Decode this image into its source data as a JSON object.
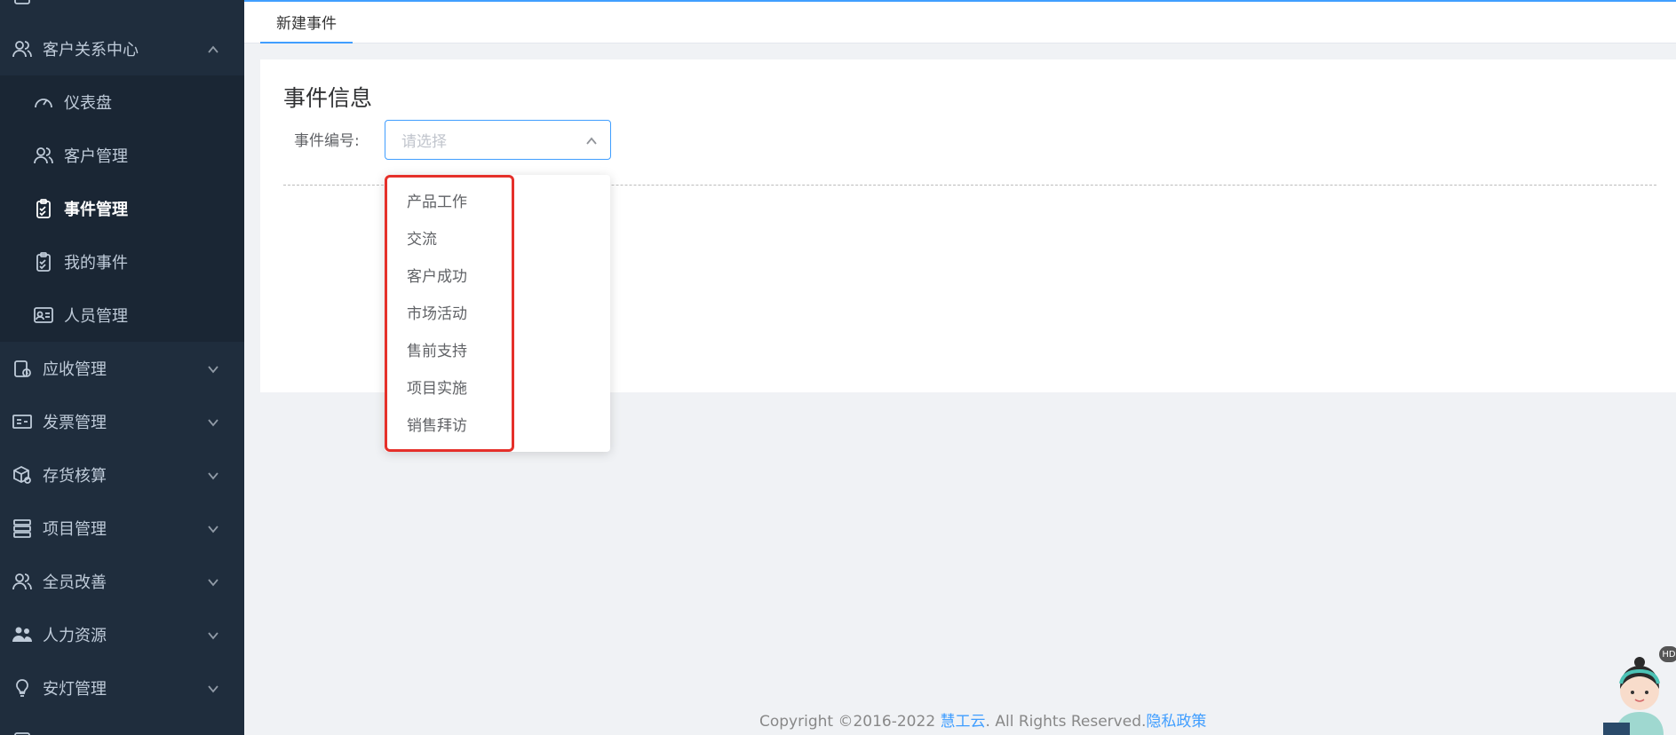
{
  "sidebar": {
    "crm": {
      "label": "客户关系中心"
    },
    "crm_items": [
      {
        "label": "仪表盘"
      },
      {
        "label": "客户管理"
      },
      {
        "label": "事件管理"
      },
      {
        "label": "我的事件"
      },
      {
        "label": "人员管理"
      }
    ],
    "groups": [
      {
        "label": "应收管理"
      },
      {
        "label": "发票管理"
      },
      {
        "label": "存货核算"
      },
      {
        "label": "项目管理"
      },
      {
        "label": "全员改善"
      },
      {
        "label": "人力资源"
      },
      {
        "label": "安灯管理"
      }
    ]
  },
  "tabs": [
    {
      "label": "新建事件"
    }
  ],
  "form": {
    "title": "事件信息",
    "event_number_label": "事件编号:",
    "event_number_placeholder": "请选择"
  },
  "dropdown": {
    "options": [
      "产品工作",
      "交流",
      "客户成功",
      "市场活动",
      "售前支持",
      "项目实施",
      "销售拜访"
    ]
  },
  "footer": {
    "copyright": "Copyright ©2016-2022 ",
    "brand": "慧工云",
    "rights": ". All Rights Reserved.",
    "privacy": "隐私政策"
  },
  "assistant": {
    "badge": "HD"
  },
  "colors": {
    "sidebar_bg": "#1f2d3d",
    "accent": "#409eff",
    "highlight": "#e5302a"
  }
}
